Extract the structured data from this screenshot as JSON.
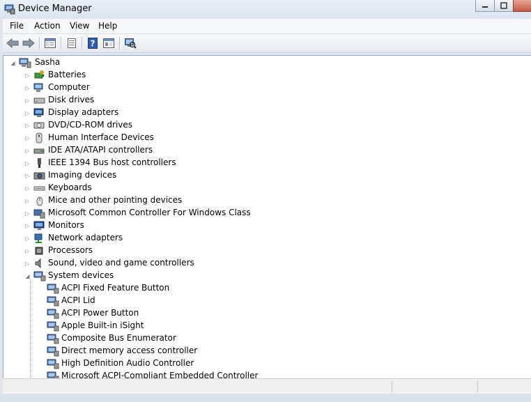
{
  "window": {
    "title": "Device Manager",
    "icon": "device-manager-icon"
  },
  "menu": [
    "File",
    "Action",
    "View",
    "Help"
  ],
  "toolbar": [
    "back-arrow-icon",
    "forward-arrow-icon",
    "show-hide-tree-icon",
    "properties-icon",
    "help-icon",
    "view-options-icon",
    "scan-hardware-icon"
  ],
  "tree": {
    "root": {
      "label": "Sasha",
      "icon": "computer-icon"
    },
    "categories": [
      {
        "label": "Batteries",
        "icon": "battery-icon"
      },
      {
        "label": "Computer",
        "icon": "computer-icon"
      },
      {
        "label": "Disk drives",
        "icon": "disk-drive-icon"
      },
      {
        "label": "Display adapters",
        "icon": "display-adapter-icon"
      },
      {
        "label": "DVD/CD-ROM drives",
        "icon": "dvd-drive-icon"
      },
      {
        "label": "Human Interface Devices",
        "icon": "hid-icon"
      },
      {
        "label": "IDE ATA/ATAPI controllers",
        "icon": "ide-controller-icon"
      },
      {
        "label": "IEEE 1394 Bus host controllers",
        "icon": "firewire-icon"
      },
      {
        "label": "Imaging devices",
        "icon": "camera-icon"
      },
      {
        "label": "Keyboards",
        "icon": "keyboard-icon"
      },
      {
        "label": "Mice and other pointing devices",
        "icon": "mouse-icon"
      },
      {
        "label": "Microsoft Common Controller For Windows Class",
        "icon": "controller-icon"
      },
      {
        "label": "Monitors",
        "icon": "monitor-icon"
      },
      {
        "label": "Network adapters",
        "icon": "network-adapter-icon"
      },
      {
        "label": "Processors",
        "icon": "processor-icon"
      },
      {
        "label": "Sound, video and game controllers",
        "icon": "speaker-icon"
      },
      {
        "label": "System devices",
        "icon": "system-device-icon"
      }
    ],
    "system_devices": [
      "ACPI Fixed Feature Button",
      "ACPI Lid",
      "ACPI Power Button",
      "Apple Built-in iSight",
      "Composite Bus Enumerator",
      "Direct memory access controller",
      "High Definition Audio Controller",
      "Microsoft ACPI-Compliant Embedded Controller"
    ]
  },
  "colors": {
    "tree_bg": "#ffffff",
    "frame": "#dfe6ee",
    "accent": "#2a5db0"
  }
}
